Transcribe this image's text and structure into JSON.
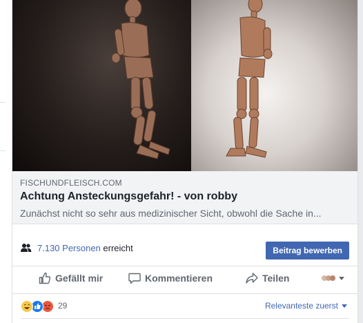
{
  "link_preview": {
    "domain": "FISCHUNDFLEISCH.COM",
    "title": "Achtung Ansteckungsgefahr! - von robby",
    "description": "Zunächst nicht so sehr aus medizinischer Sicht, obwohl die Sache in..."
  },
  "reach": {
    "count_text": "7.130 Personen",
    "suffix": " erreicht",
    "promote_label": "Beitrag bewerben"
  },
  "actions": {
    "like": "Gefällt mir",
    "comment": "Kommentieren",
    "share": "Teilen"
  },
  "reactions": {
    "count": "29",
    "sort_label": "Relevanteste zuerst",
    "icons": [
      "haha-icon",
      "like-icon",
      "angry-icon"
    ]
  },
  "colors": {
    "accent": "#4267b2",
    "text_muted": "#606770"
  }
}
